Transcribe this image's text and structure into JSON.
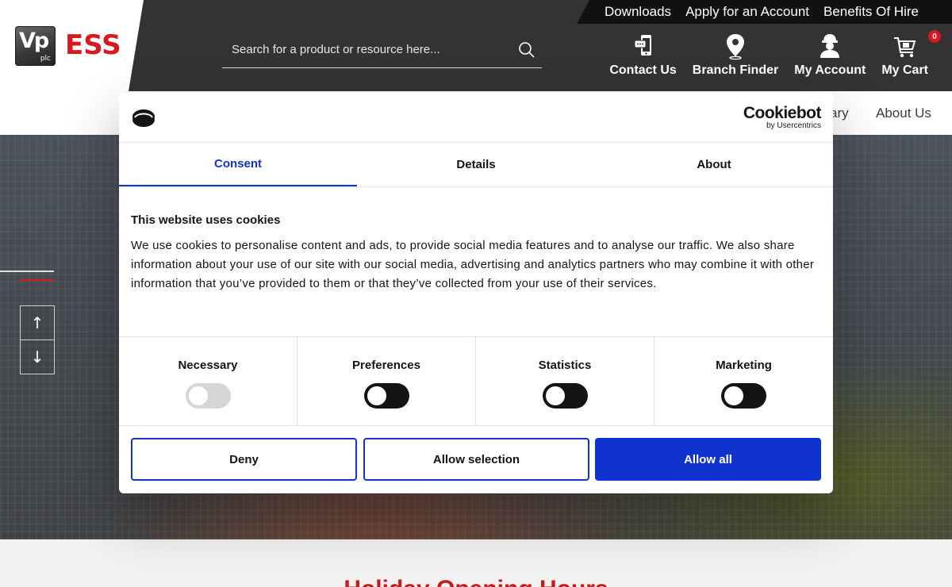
{
  "header": {
    "logo_vp": "Vp",
    "logo_plc": "plc",
    "logo_brand": "ESS",
    "top_links": [
      "Downloads",
      "Apply for an Account",
      "Benefits Of Hire"
    ],
    "search_placeholder": "Search for a product or resource here...",
    "nav": {
      "contact": "Contact Us",
      "branch": "Branch Finder",
      "account": "My Account",
      "cart": "My Cart",
      "cart_count": "0"
    }
  },
  "sub_nav": {
    "partial_item": "ary",
    "about": "About Us"
  },
  "hero": {
    "arrow_up": "↑",
    "arrow_down": "↓"
  },
  "below_hero": {
    "heading": "Holiday Opening Hours"
  },
  "cookie_dialog": {
    "brand": "Cookiebot",
    "brand_sub": "by Usercentrics",
    "tabs": [
      "Consent",
      "Details",
      "About"
    ],
    "active_tab": "Consent",
    "title": "This website uses cookies",
    "body": "We use cookies to personalise content and ads, to provide social media features and to analyse our traffic. We also share information about your use of our site with our social media, advertising and analytics partners who may combine it with other information that you’ve provided to them or that they’ve collected from your use of their services.",
    "categories": [
      {
        "label": "Necessary",
        "enabled": false,
        "disabled": true
      },
      {
        "label": "Preferences",
        "enabled": false,
        "disabled": false
      },
      {
        "label": "Statistics",
        "enabled": false,
        "disabled": false
      },
      {
        "label": "Marketing",
        "enabled": false,
        "disabled": false
      }
    ],
    "buttons": {
      "deny": "Deny",
      "allow_selection": "Allow selection",
      "allow_all": "Allow all"
    }
  },
  "colors": {
    "brand_red": "#d71920",
    "dark_header": "#333333",
    "accent_blue": "#1032cf"
  }
}
